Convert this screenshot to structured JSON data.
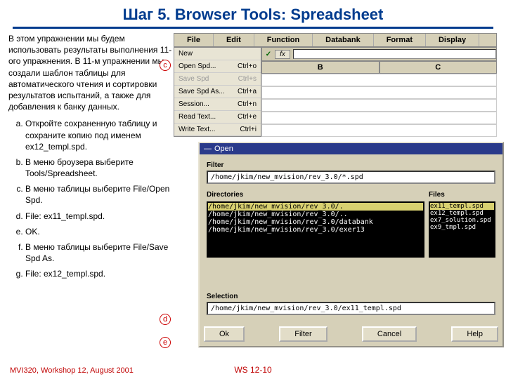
{
  "title": "Шаг 5.  Browser Tools:  Spreadsheet",
  "intro": "В этом упражнении мы будем использовать результаты выполнения 11-ого упражнения. В 11-м упражнении мы создали шаблон таблицы для автоматического чтения и сортировки результатов испытаний, а также для добавления к банку данных.",
  "steps": {
    "a": "Откройте сохраненную таблицу и сохраните копию под именем ex12_templ.spd.",
    "b": "В меню броузера выберите Tools/Spreadsheet.",
    "c": "В меню таблицы выберите File/Open Spd.",
    "d": "File: ex11_templ.spd.",
    "e": "OK.",
    "f": " В меню таблицы выберите File/Save Spd As.",
    "g": "File: ex12_templ.spd."
  },
  "menubar": {
    "file": "File",
    "edit": "Edit",
    "func": "Function",
    "db": "Databank",
    "fmt": "Format",
    "disp": "Display"
  },
  "filemenu": {
    "new": {
      "label": "New",
      "k": ""
    },
    "open": {
      "label": "Open Spd...",
      "k": "Ctrl+o"
    },
    "save": {
      "label": "Save Spd",
      "k": "Ctrl+s"
    },
    "saveas": {
      "label": "Save Spd As...",
      "k": "Ctrl+a"
    },
    "session": {
      "label": "Session...",
      "k": "Ctrl+n"
    },
    "read": {
      "label": "Read Text...",
      "k": "Ctrl+e"
    },
    "write": {
      "label": "Write Text...",
      "k": "Ctrl+i"
    }
  },
  "cols": {
    "b": "B",
    "c": "C"
  },
  "fx": {
    "check": "✓",
    "fx": "fx"
  },
  "dialog": {
    "title": "Open",
    "filter_lbl": "Filter",
    "filter_val": "/home/jkim/new_mvision/rev_3.0/*.spd",
    "dirs_lbl": "Directories",
    "files_lbl": "Files",
    "dirs": [
      "/home/jkim/new_mvision/rev_3.0/.",
      "/home/jkim/new_mvision/rev_3.0/..",
      "/home/jkim/new_mvision/rev_3.0/databank",
      "/home/jkim/new_mvision/rev_3.0/exer13"
    ],
    "files": [
      "ex11_templ.spd",
      "ex12_templ.spd",
      "ex7_solution.spd",
      "ex9_tmpl.spd"
    ],
    "sel_lbl": "Selection",
    "sel_val": "/home/jkim/new_mvision/rev_3.0/ex11_templ.spd",
    "btn_ok": "Ok",
    "btn_filter": "Filter",
    "btn_cancel": "Cancel",
    "btn_help": "Help"
  },
  "callouts": {
    "c": "c",
    "d": "d",
    "e": "e"
  },
  "footer": {
    "left": "MVI320, Workshop 12, August 2001",
    "center": "WS 12-10"
  }
}
